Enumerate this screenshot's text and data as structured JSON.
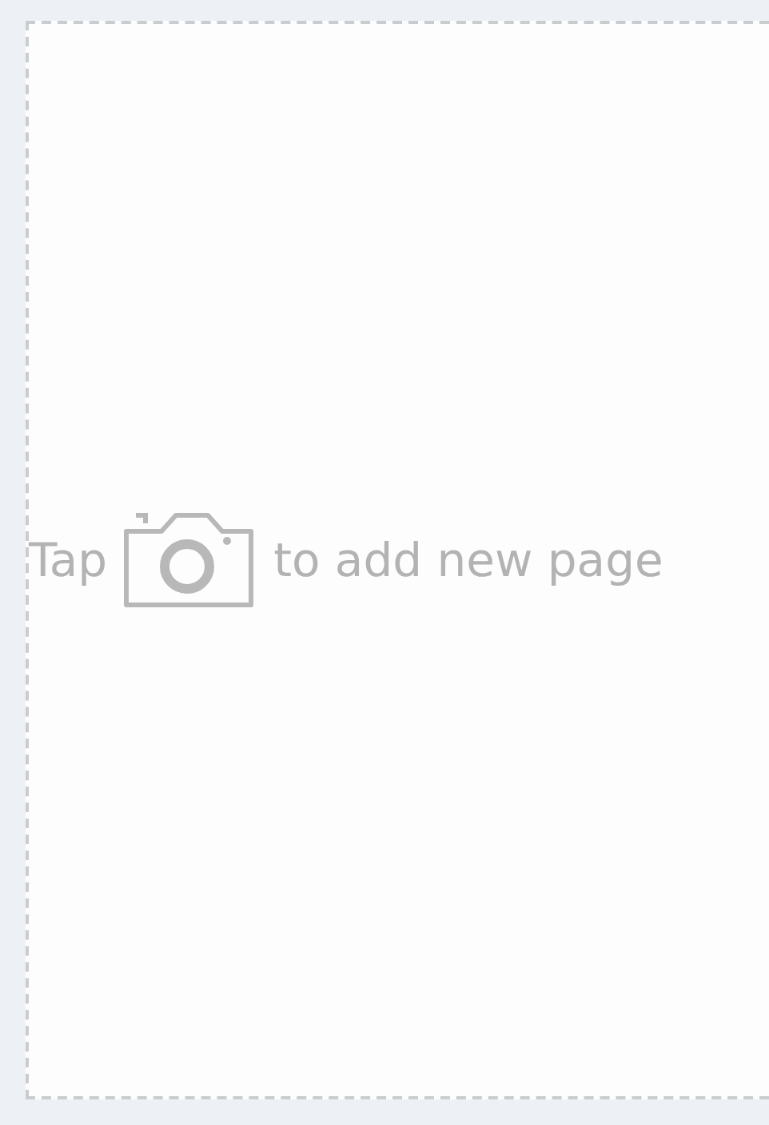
{
  "empty_state": {
    "prefix": "Tap",
    "suffix": "to add new page"
  }
}
